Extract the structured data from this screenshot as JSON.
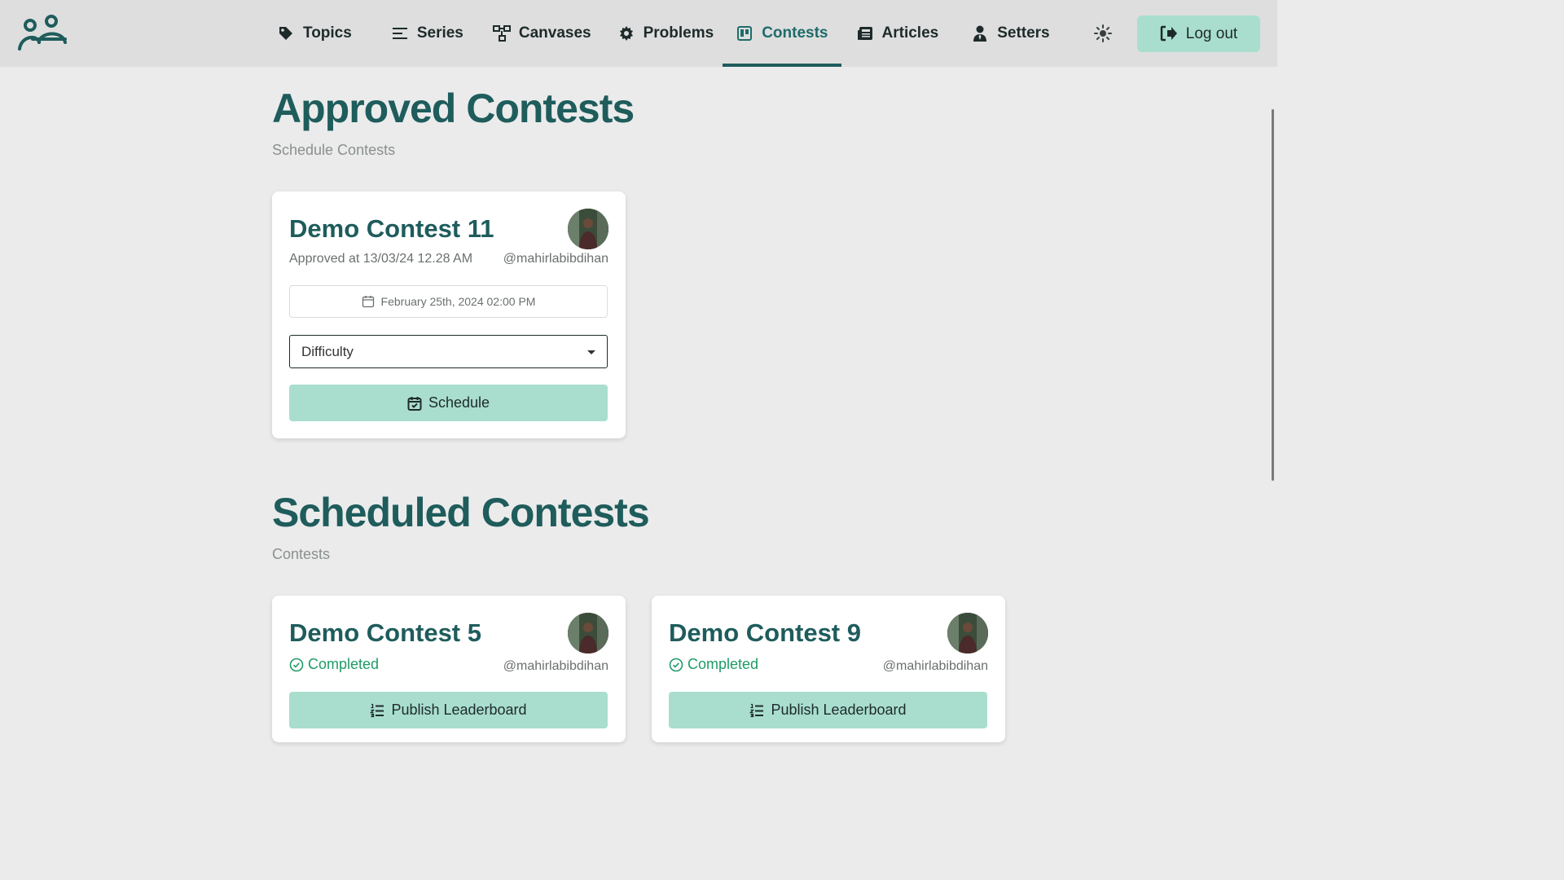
{
  "nav": {
    "items": [
      {
        "label": "Topics",
        "icon": "tag-icon"
      },
      {
        "label": "Series",
        "icon": "list-icon"
      },
      {
        "label": "Canvases",
        "icon": "diagram-icon"
      },
      {
        "label": "Problems",
        "icon": "puzzle-icon"
      },
      {
        "label": "Contests",
        "icon": "board-icon",
        "active": true
      },
      {
        "label": "Articles",
        "icon": "newspaper-icon"
      },
      {
        "label": "Setters",
        "icon": "user-tie-icon"
      }
    ],
    "logout_label": "Log out"
  },
  "approved": {
    "title": "Approved Contests",
    "subtitle": "Schedule Contests",
    "cards": [
      {
        "title": "Demo Contest 11",
        "approved_at": "Approved at 13/03/24 12.28 AM",
        "handle": "@mahirlabibdihan",
        "date": "February 25th, 2024 02:00 PM",
        "difficulty_placeholder": "Difficulty",
        "schedule_label": "Schedule"
      }
    ]
  },
  "scheduled": {
    "title": "Scheduled Contests",
    "subtitle": "Contests",
    "cards": [
      {
        "title": "Demo Contest 5",
        "status": "Completed",
        "handle": "@mahirlabibdihan",
        "action_label": "Publish Leaderboard"
      },
      {
        "title": "Demo Contest 9",
        "status": "Completed",
        "handle": "@mahirlabibdihan",
        "action_label": "Publish Leaderboard"
      }
    ]
  },
  "colors": {
    "brand": "#1f5c5c",
    "button": "#a9dece",
    "success": "#1e9b67",
    "background": "#ebebeb",
    "navbar": "#dedede"
  }
}
